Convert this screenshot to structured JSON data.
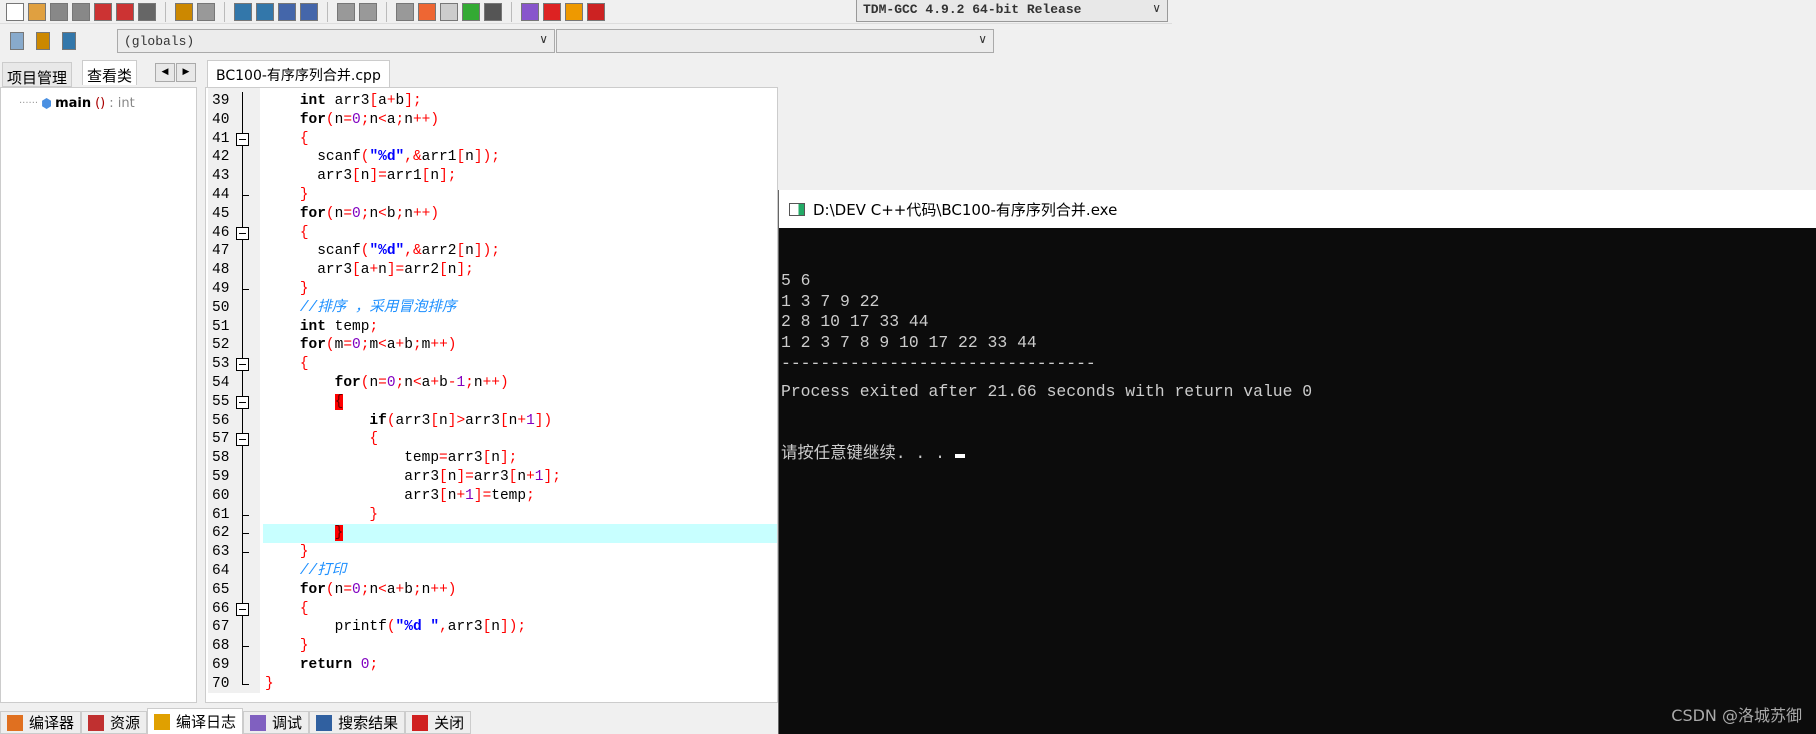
{
  "toolbar": {
    "icons": [
      "new-file-icon",
      "open-file-icon",
      "save-icon",
      "save-all-icon",
      "close-icon",
      "close-all-icon",
      "print-icon",
      "undo-icon",
      "redo-icon",
      "find-icon",
      "replace-icon",
      "indent-icon",
      "unindent-icon",
      "compile-icon",
      "run-icon",
      "debug-icon",
      "new-project-icon",
      "options-icon",
      "windows-icon",
      "grid-icon",
      "check-icon",
      "stop-icon",
      "chart-icon",
      "delete-icon"
    ],
    "compiler": "TDM-GCC 4.9.2 64-bit Release",
    "row2_icons": [
      "insert-icon",
      "add-icon",
      "bookmark-icon"
    ],
    "scope": "(globals)",
    "function": ""
  },
  "left_tabs": {
    "project": "项目管理",
    "classes": "查看类"
  },
  "class_tree": {
    "name": "main",
    "parens": "()",
    "type": ": int"
  },
  "file_tab": "BC100-有序序列合并.cpp",
  "code": [
    {
      "n": "39",
      "t": "    int arr3[a+b];",
      "f": "line"
    },
    {
      "n": "40",
      "t": "    for(n=0;n<a;n++)",
      "f": "line"
    },
    {
      "n": "41",
      "t": "    {",
      "f": "box"
    },
    {
      "n": "42",
      "t": "      scanf(\"%d\",&arr1[n]);",
      "f": "line"
    },
    {
      "n": "43",
      "t": "      arr3[n]=arr1[n];",
      "f": "line"
    },
    {
      "n": "44",
      "t": "    }",
      "f": "tick"
    },
    {
      "n": "45",
      "t": "    for(n=0;n<b;n++)",
      "f": "line"
    },
    {
      "n": "46",
      "t": "    {",
      "f": "box"
    },
    {
      "n": "47",
      "t": "      scanf(\"%d\",&arr2[n]);",
      "f": "line"
    },
    {
      "n": "48",
      "t": "      arr3[a+n]=arr2[n];",
      "f": "line"
    },
    {
      "n": "49",
      "t": "    }",
      "f": "tick"
    },
    {
      "n": "50",
      "t": "    //排序 ，采用冒泡排序",
      "f": "line"
    },
    {
      "n": "51",
      "t": "    int temp;",
      "f": "line"
    },
    {
      "n": "52",
      "t": "    for(m=0;m<a+b;m++)",
      "f": "line"
    },
    {
      "n": "53",
      "t": "    {",
      "f": "box"
    },
    {
      "n": "54",
      "t": "        for(n=0;n<a+b-1;n++)",
      "f": "line"
    },
    {
      "n": "55",
      "t": "        {",
      "f": "box",
      "match": true
    },
    {
      "n": "56",
      "t": "            if(arr3[n]>arr3[n+1])",
      "f": "line"
    },
    {
      "n": "57",
      "t": "            {",
      "f": "box"
    },
    {
      "n": "58",
      "t": "                temp=arr3[n];",
      "f": "line"
    },
    {
      "n": "59",
      "t": "                arr3[n]=arr3[n+1];",
      "f": "line"
    },
    {
      "n": "60",
      "t": "                arr3[n+1]=temp;",
      "f": "line"
    },
    {
      "n": "61",
      "t": "            }",
      "f": "tick"
    },
    {
      "n": "62",
      "t": "        }",
      "f": "tick",
      "match": true,
      "current": true
    },
    {
      "n": "63",
      "t": "    }",
      "f": "tick"
    },
    {
      "n": "64",
      "t": "    //打印",
      "f": "line"
    },
    {
      "n": "65",
      "t": "    for(n=0;n<a+b;n++)",
      "f": "line"
    },
    {
      "n": "66",
      "t": "    {",
      "f": "box"
    },
    {
      "n": "67",
      "t": "        printf(\"%d \",arr3[n]);",
      "f": "line"
    },
    {
      "n": "68",
      "t": "    }",
      "f": "tick"
    },
    {
      "n": "69",
      "t": "    return 0;",
      "f": "line"
    },
    {
      "n": "70",
      "t": "}",
      "f": "end"
    }
  ],
  "bottom_tabs": [
    {
      "label": "编译器",
      "icon": "compiler-icon",
      "color": "#e07020"
    },
    {
      "label": "资源",
      "icon": "resources-icon",
      "color": "#c03030"
    },
    {
      "label": "编译日志",
      "icon": "compile-log-icon",
      "color": "#e0a000",
      "active": true
    },
    {
      "label": "调试",
      "icon": "debug-check-icon",
      "color": "#8060c0"
    },
    {
      "label": "搜索结果",
      "icon": "search-results-icon",
      "color": "#3060a0"
    },
    {
      "label": "关闭",
      "icon": "close-panel-icon",
      "color": "#d02020"
    }
  ],
  "console": {
    "title": "D:\\DEV C++代码\\BC100-有序序列合并.exe",
    "lines": [
      "5 6",
      "1 3 7 9 22",
      "2 8 10 17 33 44",
      "1 2 3 7 8 9 10 17 22 33 44",
      "--------------------------------",
      "Process exited after 21.66 seconds with return value 0"
    ],
    "prompt": "请按任意键继续. . . "
  },
  "watermark": "CSDN @洛城苏御"
}
